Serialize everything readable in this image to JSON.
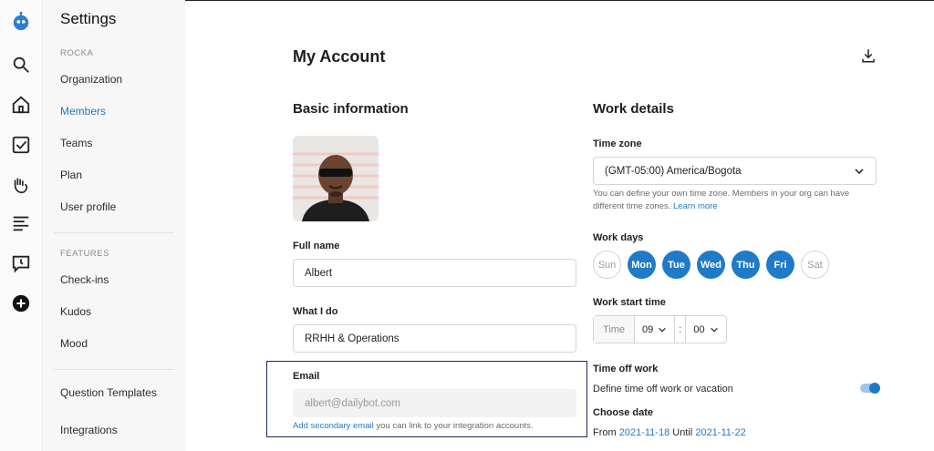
{
  "sidebar": {
    "title": "Settings",
    "section_org": "ROCKA",
    "items": [
      {
        "label": "Organization"
      },
      {
        "label": "Members"
      },
      {
        "label": "Teams"
      },
      {
        "label": "Plan"
      },
      {
        "label": "User profile"
      }
    ],
    "section_features": "FEATURES",
    "features": [
      {
        "label": "Check-ins"
      },
      {
        "label": "Kudos"
      },
      {
        "label": "Mood"
      }
    ],
    "bottom": [
      {
        "label": "Question Templates"
      },
      {
        "label": "Integrations"
      }
    ]
  },
  "page": {
    "title": "My Account"
  },
  "basic": {
    "heading": "Basic information",
    "full_name_label": "Full name",
    "full_name_value": "Albert",
    "what_label": "What I do",
    "what_value": "RRHH & Operations",
    "email_label": "Email",
    "email_value": "albert@dailybot.com",
    "email_link": "Add secondary email",
    "email_hint": " you can link to your integration accounts."
  },
  "work": {
    "heading": "Work details",
    "timezone_label": "Time zone",
    "timezone_value": "(GMT-05:00) America/Bogota",
    "timezone_hint": "You can define your own time zone. Members in your org can have different time zones. ",
    "timezone_link": "Learn more",
    "days_label": "Work days",
    "days": [
      "Sun",
      "Mon",
      "Tue",
      "Wed",
      "Thu",
      "Fri",
      "Sat"
    ],
    "start_label": "Work start time",
    "time_label": "Time",
    "hour": "09",
    "colon": ":",
    "minute": "00",
    "timeoff_label": "Time off work",
    "timeoff_desc": "Define time off work or vacation",
    "choose_label": "Choose date",
    "from_text": "From",
    "from_date": "2021-11-18",
    "until_text": "Until",
    "until_date": "2021-11-22"
  },
  "colors": {
    "accent": "#1f7ac7",
    "focus_border": "#1a2a5a"
  }
}
